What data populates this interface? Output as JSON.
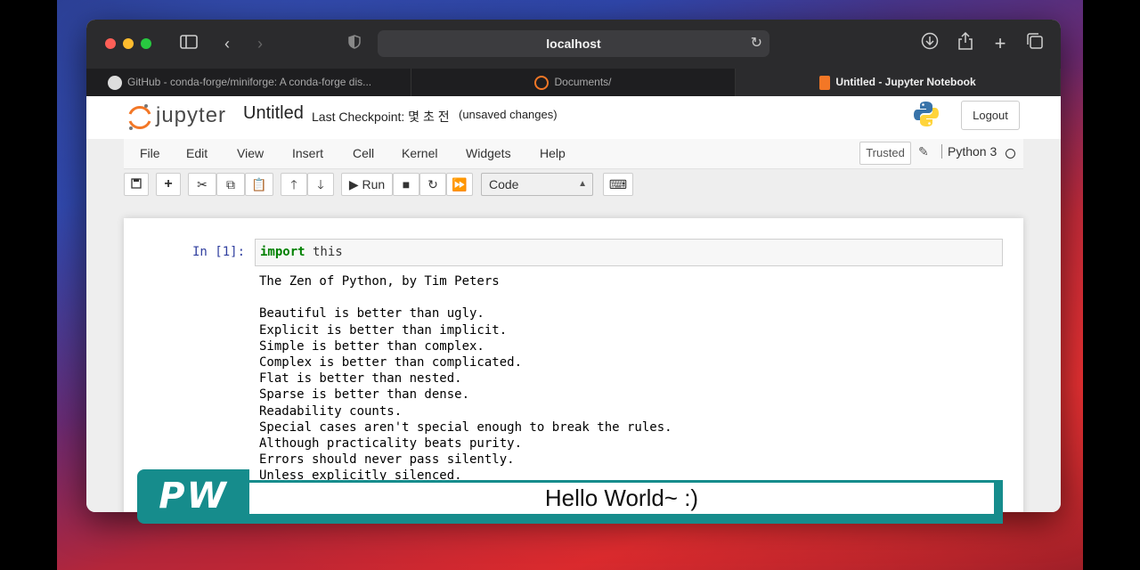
{
  "browser": {
    "address": "localhost",
    "tabs": [
      {
        "label": "GitHub - conda-forge/miniforge: A conda-forge dis...",
        "icon": "github-icon"
      },
      {
        "label": "Documents/",
        "icon": "jupyter-icon"
      },
      {
        "label": "Untitled - Jupyter Notebook",
        "icon": "notebook-icon"
      }
    ]
  },
  "jupyter": {
    "logo_text": "jupyter",
    "notebook_title": "Untitled",
    "checkpoint": "Last Checkpoint: 몇 초 전",
    "unsaved": "(unsaved changes)",
    "logout_label": "Logout",
    "menu": [
      "File",
      "Edit",
      "View",
      "Insert",
      "Cell",
      "Kernel",
      "Widgets",
      "Help"
    ],
    "trusted_label": "Trusted",
    "kernel_name": "Python 3",
    "run_label": "Run",
    "cell_type": "Code"
  },
  "cell": {
    "prompt": "In [1]:",
    "code_keyword": "import",
    "code_rest": " this",
    "output_lines": [
      "The Zen of Python, by Tim Peters",
      "",
      "Beautiful is better than ugly.",
      "Explicit is better than implicit.",
      "Simple is better than complex.",
      "Complex is better than complicated.",
      "Flat is better than nested.",
      "Sparse is better than dense.",
      "Readability counts.",
      "Special cases aren't special enough to break the rules.",
      "Although practicality beats purity.",
      "Errors should never pass silently.",
      "Unless explicitly silenced."
    ]
  },
  "caption": {
    "badge": "PW",
    "text": "Hello World~ :)"
  },
  "colors": {
    "caption_teal": "#168c8c",
    "prompt_blue": "#303f9f",
    "keyword_green": "#008000"
  }
}
